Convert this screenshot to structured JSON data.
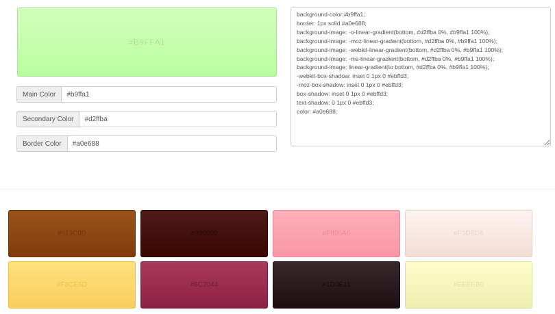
{
  "preview": {
    "label": "#B9FFA1"
  },
  "fields": [
    {
      "label": "Main Color",
      "value": "#b9ffa1"
    },
    {
      "label": "Secondary Color",
      "value": "#d2ffba"
    },
    {
      "label": "Border Color",
      "value": "#a0e688"
    }
  ],
  "css_output": "background-color:#b9ffa1;\nborder: 1px solid #a0e688;\nbackground-image: -o-linear-gradient(bottom, #d2ffba 0%, #b9ffa1 100%);\nbackground-image: -moz-linear-gradient(bottom, #d2ffba 0%, #b9ffa1 100%);\nbackground-image: -webkit-linear-gradient(bottom, #d2ffba 0%, #b9ffa1 100%);\nbackground-image: -ms-linear-gradient(bottom, #d2ffba 0%, #b9ffa1 100%);\nbackground-image: linear-gradient(to bottom, #d2ffba 0%, #b9ffa1 100%);\n-webkit-box-shadow: inset 0 1px 0 #ebffd3;\n-moz-box-shadow: inset 0 1px 0 #ebffd3;\nbox-shadow: inset 0 1px 0 #ebffd3;\ntext-shadow: 0 1px 0 #ebffd3;\ncolor: #a0e688;",
  "swatches": [
    {
      "label": "#813C0D",
      "top": "#9a5419",
      "bottom": "#813c0d",
      "text": "#5a2a08",
      "border": "#6d3109"
    },
    {
      "label": "#390600",
      "top": "#4e1d18",
      "bottom": "#390600",
      "text": "#1c0300",
      "border": "#2a0400"
    },
    {
      "label": "#F896A6",
      "top": "#ffaeb8",
      "bottom": "#f896a6",
      "text": "#e07d8f",
      "border": "#e88596"
    },
    {
      "label": "#F3DED6",
      "top": "#fdf3ee",
      "bottom": "#f3ded6",
      "text": "#dcc6bd",
      "border": "#e5d0c8"
    },
    {
      "label": "#F8CE5D",
      "top": "#ffe17e",
      "bottom": "#f8ce5d",
      "text": "#e0b644",
      "border": "#e8be4c"
    },
    {
      "label": "#8C2044",
      "top": "#a93a5c",
      "bottom": "#8c2044",
      "text": "#5e1530",
      "border": "#781a39"
    },
    {
      "label": "#1D0E11",
      "top": "#382a2c",
      "bottom": "#1d0e11",
      "text": "#070304",
      "border": "#120809"
    },
    {
      "label": "#EEEEB0",
      "top": "#fffdca",
      "bottom": "#eeeeb0",
      "text": "#d6d697",
      "border": "#dcdc9e"
    }
  ]
}
